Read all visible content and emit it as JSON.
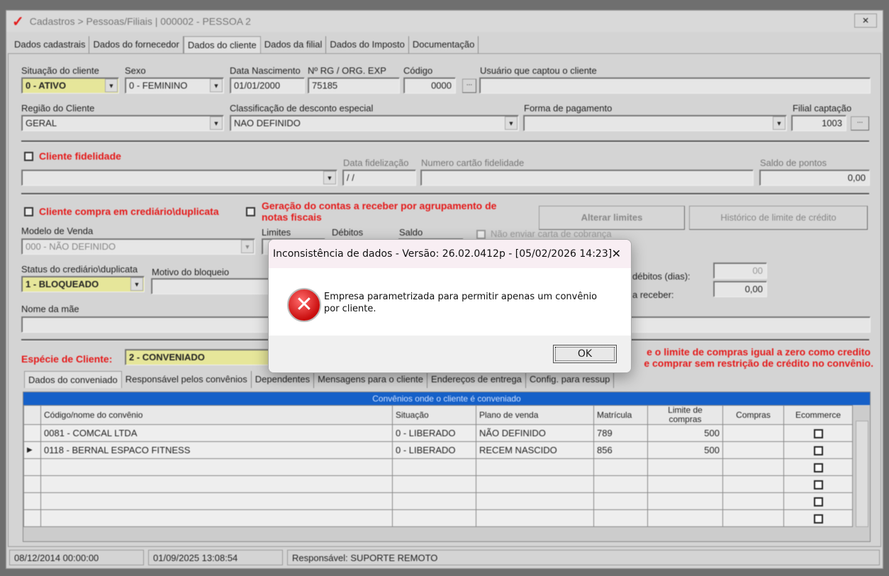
{
  "window": {
    "title": "Cadastros > Pessoas/Filiais | 000002 - PESSOA 2",
    "close": "✕"
  },
  "tabs": [
    "Dados cadastrais",
    "Dados do fornecedor",
    "Dados do cliente",
    "Dados da filial",
    "Dados do Imposto",
    "Documentação"
  ],
  "form": {
    "situacao_label": "Situação do cliente",
    "situacao": "0 - ATIVO",
    "sexo_label": "Sexo",
    "sexo": "0 - FEMININO",
    "nasc_label": "Data Nascimento",
    "nasc": "01/01/2000",
    "rg_label": "Nº RG / ORG. EXP",
    "rg": "75185",
    "codigo_label": "Código",
    "codigo": "0000",
    "usuario_label": "Usuário que captou o cliente",
    "usuario": "",
    "regiao_label": "Região do Cliente",
    "regiao": "GERAL",
    "classif_label": "Classificação de desconto especial",
    "classif": "NAO DEFINIDO",
    "pagto_label": "Forma de pagamento",
    "pagto": "",
    "filial_label": "Filial captação",
    "filial": "1003",
    "fidelidade_label": "Cliente fidelidade",
    "data_fid_label": "Data fidelização",
    "data_fid": "/ /",
    "cartao_label": "Numero cartão fidelidade",
    "saldo_pontos_label": "Saldo de pontos",
    "saldo_pontos": "0,00",
    "crediario_label": "Cliente compra em crediário\\duplicata",
    "geracao_label": "Geração do contas a receber por agrupamento de notas fiscais",
    "alterar_limites": "Alterar limites",
    "historico": "Histórico de limite de crédito",
    "modelo_label": "Modelo de Venda",
    "modelo": "000 - NÃO DEFINIDO",
    "limites_label": "Limites",
    "debitos_label": "Débitos",
    "saldo_label": "Saldo",
    "nao_enviar": "Não enviar carta de cobrança",
    "status_label": "Status do crediário\\duplicata",
    "status": "1 - BLOQUEADO",
    "motivo_label": "Motivo do bloqueio",
    "debitos_dias_label": "débitos (dias):",
    "debitos_dias": "00",
    "receber_label": "a receber:",
    "receber": "0,00",
    "mae_label": "Nome da mãe",
    "especie_label": "Espécie de Cliente:",
    "especie": "2 - CONVENIADO",
    "aviso1": "e o limite de compras igual a zero como credito",
    "aviso2": "e comprar sem restrição de crédito no convênio."
  },
  "subtabs": [
    "Dados do conveniado",
    "Responsável pelos convênios",
    "Dependentes",
    "Mensagens para o cliente",
    "Endereços de entrega",
    "Config. para ressup"
  ],
  "grid": {
    "caption": "Convênios onde o cliente é conveniado",
    "headers": [
      "Código/nome do convênio",
      "Situação",
      "Plano de venda",
      "Matrícula",
      "Limite de compras",
      "Compras",
      "Ecommerce"
    ],
    "rows": [
      [
        "0081 - COMCAL LTDA",
        "0 - LIBERADO",
        "NÃO DEFINIDO",
        "789",
        "500",
        ""
      ],
      [
        "0118 - BERNAL ESPACO FITNESS",
        "0 - LIBERADO",
        "RECEM NASCIDO",
        "856",
        "500",
        ""
      ]
    ],
    "empty_rows": 4,
    "selected_row": 1
  },
  "statusbar": [
    "08/12/2014 00:00:00",
    "01/09/2025 13:08:54",
    "Responsável: SUPORTE REMOTO"
  ],
  "dialog": {
    "title": "Inconsistência de dados - Versão: 26.02.0412p - [05/02/2026 14:23]",
    "message": "Empresa parametrizada para permitir apenas um convênio por cliente.",
    "ok": "OK",
    "close": "✕",
    "icon": "error-icon"
  },
  "colors": {
    "accent_red": "#e41b1b",
    "grid_header": "#1560c8",
    "highlight": "#e6e69a"
  }
}
